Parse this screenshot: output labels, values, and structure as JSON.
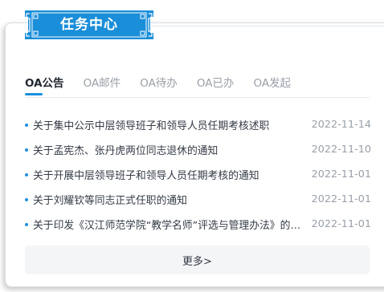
{
  "header": {
    "title": "任务中心"
  },
  "tabs": [
    {
      "label": "OA公告",
      "active": true
    },
    {
      "label": "OA邮件",
      "active": false
    },
    {
      "label": "OA待办",
      "active": false
    },
    {
      "label": "OA已办",
      "active": false
    },
    {
      "label": "OA发起",
      "active": false
    }
  ],
  "notices": [
    {
      "title": "关于集中公示中层领导班子和领导人员任期考核述职",
      "date": "2022-11-14"
    },
    {
      "title": "关于孟宪杰、张丹虎两位同志退休的通知",
      "date": "2022-11-10"
    },
    {
      "title": "关于开展中层领导班子和领导人员任期考核的通知",
      "date": "2022-11-01"
    },
    {
      "title": "关于刘耀钦等同志正式任职的通知",
      "date": "2022-11-01"
    },
    {
      "title": "关于印发《汉江师范学院“教学名师”评选与管理办法》的通知",
      "date": "2022-11-01"
    }
  ],
  "more_label": "更多>",
  "colors": {
    "accent": "#1d8fde",
    "badge_bg": "#1b8ed9"
  }
}
